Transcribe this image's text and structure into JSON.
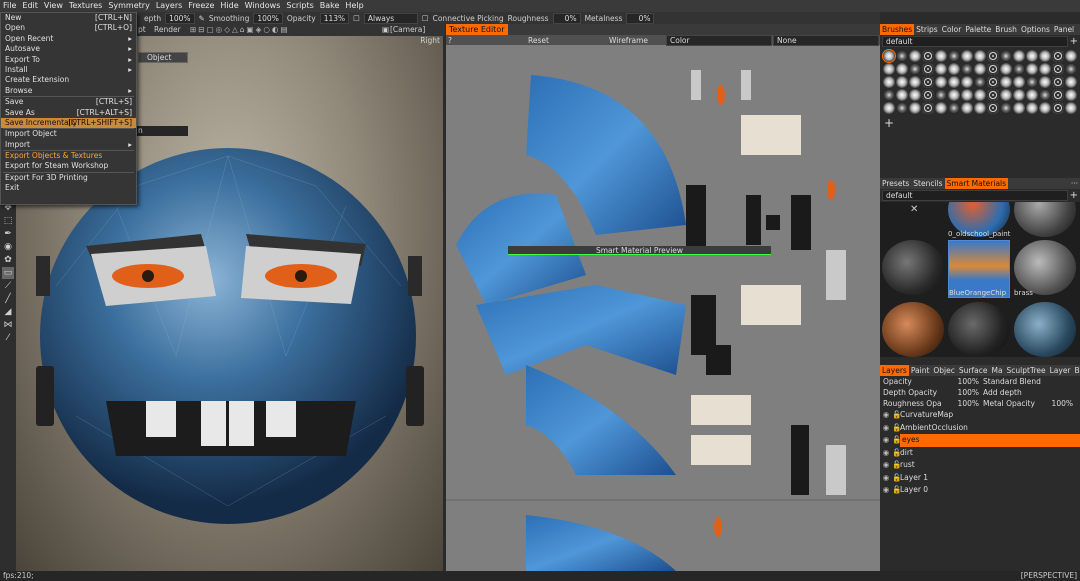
{
  "menubar": {
    "items": [
      "File",
      "Edit",
      "View",
      "Textures",
      "Symmetry",
      "Layers",
      "Freeze",
      "Hide",
      "Windows",
      "Scripts",
      "Bake",
      "Help"
    ]
  },
  "toolbar1": {
    "depth_label": "epth",
    "depth_value": "100%",
    "smoothing_label": "Smoothing",
    "smoothing_value": "100%",
    "opacity_label": "Opacity",
    "opacity_value": "113%",
    "always_label": "Always",
    "connective_label": "Connective Picking",
    "roughness_label": "Roughness",
    "roughness_value": "0%",
    "metalness_label": "Metalness",
    "metalness_value": "0%"
  },
  "toolbar2": {
    "pt_label": "pt",
    "render_label": "Render",
    "camera_label": "[Camera]",
    "right_label": "Right",
    "object_label": "Object",
    "n_label": "n"
  },
  "file_menu": {
    "items": [
      {
        "label": "New",
        "shortcut": "[CTRL+N]"
      },
      {
        "label": "Open",
        "shortcut": "[CTRL+O]"
      },
      {
        "label": "Open Recent",
        "shortcut": "▸"
      },
      {
        "label": "Autosave",
        "shortcut": "▸"
      },
      {
        "label": "Export To",
        "shortcut": "▸"
      },
      {
        "label": "Install",
        "shortcut": "▸"
      },
      {
        "label": "Create Extension",
        "shortcut": ""
      },
      {
        "label": "Browse",
        "shortcut": "▸"
      },
      {
        "label": "Save",
        "shortcut": "[CTRL+S]"
      },
      {
        "label": "Save As",
        "shortcut": "[CTRL+ALT+S]"
      },
      {
        "label": "Save Incrementally",
        "shortcut": "[CTRL+SHIFT+S]"
      },
      {
        "label": "Import Object",
        "shortcut": ""
      },
      {
        "label": "Import",
        "shortcut": "▸"
      },
      {
        "label": "Export Objects & Textures",
        "shortcut": ""
      },
      {
        "label": "Export for Steam Workshop",
        "shortcut": ""
      },
      {
        "label": "Export For 3D Printing",
        "shortcut": ""
      },
      {
        "label": "Exit",
        "shortcut": ""
      }
    ]
  },
  "texture_editor": {
    "tab": "Texture Editor",
    "question": "?",
    "reset": "Reset",
    "wireframe": "Wireframe",
    "color_select": "Color",
    "none_select": "None",
    "preview_label": "Smart Material Preview"
  },
  "brushes_panel": {
    "tabs": [
      "Brushes",
      "Strips",
      "Color",
      "Palette",
      "Brush",
      "Options",
      "Panel"
    ],
    "preset": "default",
    "more": "···",
    "add": "+"
  },
  "presets_panel": {
    "tabs": [
      "Presets",
      "Stencils",
      "Smart Materials"
    ],
    "preset": "default",
    "more": "···",
    "add": "+",
    "close": "✕",
    "materials": [
      {
        "name": "0_oldschool_paint"
      },
      {
        "name": "BlueOrangeChip"
      },
      {
        "name": "brass"
      }
    ]
  },
  "layers_panel": {
    "tabs": [
      "Layers",
      "Paint",
      "Objec",
      "Surface",
      "Ma",
      "SculptTree",
      "Layer",
      "Blendi"
    ],
    "opacity_label": "Opacity",
    "opacity_value": "100%",
    "blend_mode": "Standard Blend",
    "depth_label": "Depth Opacity",
    "depth_value": "100%",
    "depth_mode": "Add depth",
    "roughness_label": "Roughness Opa",
    "roughness_value": "100%",
    "metal_label": "Metal Opacity",
    "metal_value": "100%",
    "layers": [
      {
        "name": "CurvatureMap"
      },
      {
        "name": "AmbientOcclusion"
      },
      {
        "name": "eyes",
        "selected": true
      },
      {
        "name": "dirt"
      },
      {
        "name": "rust"
      },
      {
        "name": "Layer 1"
      },
      {
        "name": "Layer 0"
      }
    ]
  },
  "status": {
    "fps": "fps:210;",
    "view": "[PERSPECTIVE]"
  },
  "colors": {
    "accent": "#ff6a00",
    "menu_highlight": "#c98a3a"
  }
}
